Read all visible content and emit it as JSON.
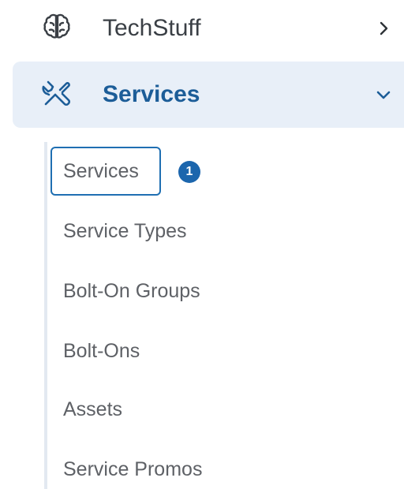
{
  "nav": {
    "techstuff": {
      "label": "TechStuff",
      "icon": "brain-icon",
      "expand_icon": "chevron-right-icon"
    },
    "services": {
      "label": "Services",
      "icon": "tools-icon",
      "expand_icon": "chevron-down-icon",
      "expanded": true,
      "children": [
        {
          "label": "Services",
          "active": true,
          "badge": "1"
        },
        {
          "label": "Service Types"
        },
        {
          "label": "Bolt-On Groups"
        },
        {
          "label": "Bolt-Ons"
        },
        {
          "label": "Assets"
        },
        {
          "label": "Service Promos"
        }
      ]
    }
  },
  "colors": {
    "active_bg": "#e8eff8",
    "accent": "#1c5d98",
    "badge_bg": "#1c66ad",
    "text": "#5e6166"
  }
}
